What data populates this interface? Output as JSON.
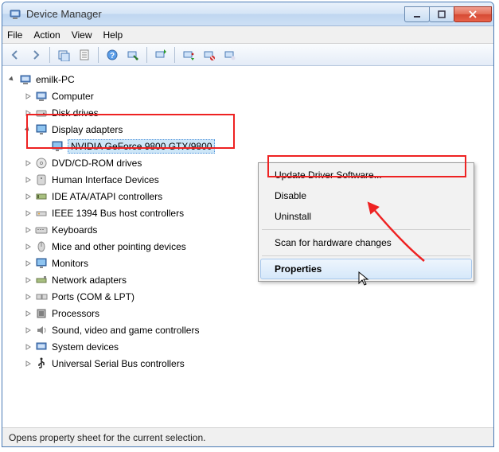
{
  "window": {
    "title": "Device Manager"
  },
  "menu": {
    "file": "File",
    "action": "Action",
    "view": "View",
    "help": "Help"
  },
  "tree": {
    "root": "emilk-PC",
    "items": [
      "Computer",
      "Disk drives",
      "Display adapters",
      "DVD/CD-ROM drives",
      "Human Interface Devices",
      "IDE ATA/ATAPI controllers",
      "IEEE 1394 Bus host controllers",
      "Keyboards",
      "Mice and other pointing devices",
      "Monitors",
      "Network adapters",
      "Ports (COM & LPT)",
      "Processors",
      "Sound, video and game controllers",
      "System devices",
      "Universal Serial Bus controllers"
    ],
    "display_child": "NVIDIA GeForce 9800 GTX/9800"
  },
  "context_menu": {
    "update": "Update Driver Software...",
    "disable": "Disable",
    "uninstall": "Uninstall",
    "scan": "Scan for hardware changes",
    "properties": "Properties"
  },
  "status": "Opens property sheet for the current selection."
}
